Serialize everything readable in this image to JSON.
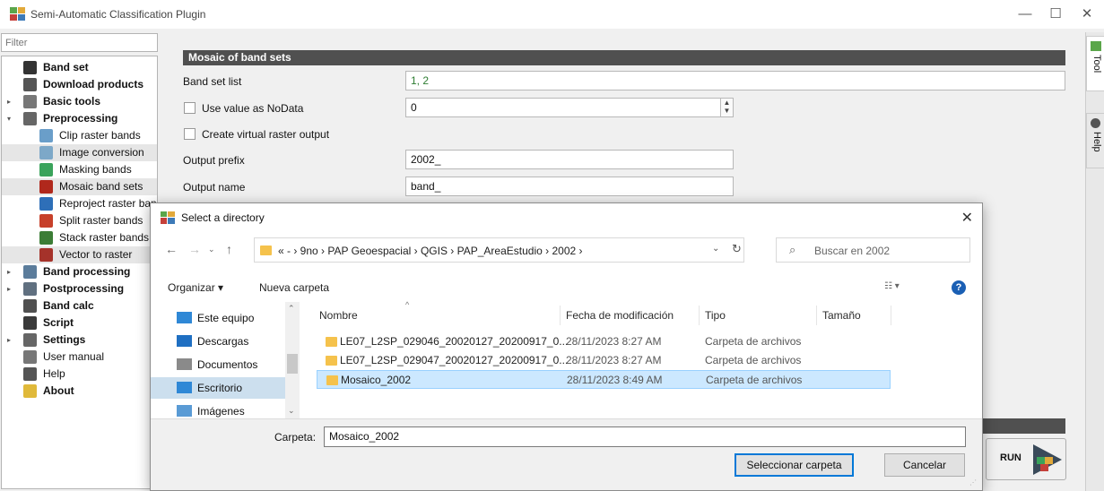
{
  "window": {
    "title": "Semi-Automatic Classification Plugin",
    "controls": [
      "—",
      "☐",
      "✕"
    ]
  },
  "sidebar": {
    "filter_placeholder": "Filter",
    "items": [
      {
        "label": "Band set",
        "bold": true,
        "arrow": "",
        "indent": 0,
        "icon_color": "#333333"
      },
      {
        "label": "Download products",
        "bold": true,
        "arrow": "",
        "indent": 0,
        "icon_color": "#555555"
      },
      {
        "label": "Basic tools",
        "bold": true,
        "arrow": "▸",
        "indent": 0,
        "icon_color": "#777777"
      },
      {
        "label": "Preprocessing",
        "bold": true,
        "arrow": "▾",
        "indent": 0,
        "icon_color": "#666666"
      },
      {
        "label": "Clip raster bands",
        "bold": false,
        "arrow": "",
        "indent": 1,
        "icon_color": "#6a9ec9"
      },
      {
        "label": "Image conversion",
        "bold": false,
        "arrow": "",
        "indent": 1,
        "icon_color": "#7da8c8",
        "selected": true
      },
      {
        "label": "Masking bands",
        "bold": false,
        "arrow": "",
        "indent": 1,
        "icon_color": "#3aa35b"
      },
      {
        "label": "Mosaic band sets",
        "bold": false,
        "arrow": "",
        "indent": 1,
        "icon_color": "#b0281c",
        "selected": true
      },
      {
        "label": "Reproject raster bands",
        "bold": false,
        "arrow": "",
        "indent": 1,
        "icon_color": "#2e6fb8"
      },
      {
        "label": "Split raster bands",
        "bold": false,
        "arrow": "",
        "indent": 1,
        "icon_color": "#c7402a"
      },
      {
        "label": "Stack raster bands",
        "bold": false,
        "arrow": "",
        "indent": 1,
        "icon_color": "#3c7d36"
      },
      {
        "label": "Vector to raster",
        "bold": false,
        "arrow": "",
        "indent": 1,
        "icon_color": "#a5322a",
        "selected": true
      },
      {
        "label": "Band processing",
        "bold": true,
        "arrow": "▸",
        "indent": 0,
        "icon_color": "#5b7c9b"
      },
      {
        "label": "Postprocessing",
        "bold": true,
        "arrow": "▸",
        "indent": 0,
        "icon_color": "#607080"
      },
      {
        "label": "Band calc",
        "bold": true,
        "arrow": "",
        "indent": 0,
        "icon_color": "#505050"
      },
      {
        "label": "Script",
        "bold": true,
        "arrow": "",
        "indent": 0,
        "icon_color": "#3a3a3a"
      },
      {
        "label": "Settings",
        "bold": true,
        "arrow": "▸",
        "indent": 0,
        "icon_color": "#666666"
      },
      {
        "label": "User manual",
        "bold": false,
        "arrow": "",
        "indent": 0,
        "icon_color": "#777777"
      },
      {
        "label": "Help",
        "bold": false,
        "arrow": "",
        "indent": 0,
        "icon_color": "#555555"
      },
      {
        "label": "About",
        "bold": true,
        "arrow": "",
        "indent": 0,
        "icon_color": "#e0b93a"
      }
    ]
  },
  "mosaic": {
    "section_title": "Mosaic of band sets",
    "band_set_list_label": "Band set list",
    "band_set_list_value": "1, 2",
    "nodata_label": "Use value as NoData",
    "nodata_value": "0",
    "virtual_label": "Create virtual raster output",
    "output_prefix_label": "Output prefix",
    "output_prefix_value": "2002_",
    "output_name_label": "Output name",
    "output_name_value": "band_",
    "run_label": "RUN"
  },
  "right_tabs": {
    "tool": "Tool",
    "help": "Help"
  },
  "dialog": {
    "title": "Select a directory",
    "breadcrumb": "« - › 9no › PAP Geoespacial › QGIS › PAP_AreaEstudio › 2002 ›",
    "search_placeholder": "Buscar en 2002",
    "organize_label": "Organizar ▾",
    "new_folder_label": "Nueva carpeta",
    "nav_items": [
      {
        "label": "Este equipo",
        "color": "#2f88d6"
      },
      {
        "label": "Descargas",
        "color": "#1f6fc2"
      },
      {
        "label": "Documentos",
        "color": "#8a8a8a"
      },
      {
        "label": "Escritorio",
        "color": "#2f88d6",
        "selected": true
      },
      {
        "label": "Imágenes",
        "color": "#5a9bd5"
      }
    ],
    "columns": {
      "name": "Nombre",
      "date": "Fecha de modificación",
      "type": "Tipo",
      "size": "Tamaño"
    },
    "files": [
      {
        "name": "LE07_L2SP_029046_20020127_20200917_0...",
        "date": "28/11/2023 8:27 AM",
        "type": "Carpeta de archivos"
      },
      {
        "name": "LE07_L2SP_029047_20020127_20200917_0...",
        "date": "28/11/2023 8:27 AM",
        "type": "Carpeta de archivos"
      },
      {
        "name": "Mosaico_2002",
        "date": "28/11/2023 8:49 AM",
        "type": "Carpeta de archivos",
        "selected": true
      }
    ],
    "folder_label": "Carpeta:",
    "folder_value": "Mosaico_2002",
    "select_button": "Seleccionar carpeta",
    "cancel_button": "Cancelar"
  }
}
